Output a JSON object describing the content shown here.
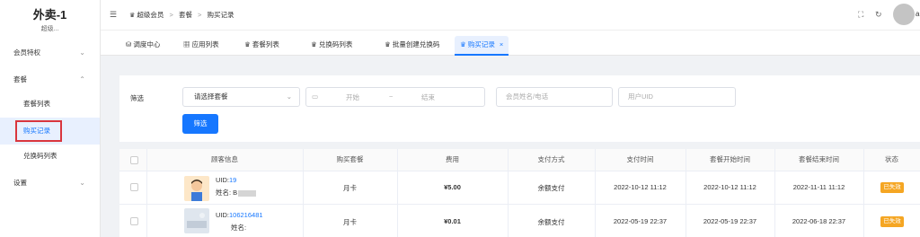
{
  "brand": {
    "title": "外卖-1",
    "subtitle": "超级..."
  },
  "sidebar": {
    "items": [
      {
        "label": "会员特权"
      },
      {
        "label": "套餐"
      },
      {
        "label": "套餐列表"
      },
      {
        "label": "购买记录"
      },
      {
        "label": "兑换码列表"
      },
      {
        "label": "设置"
      }
    ]
  },
  "header": {
    "breadcrumb": [
      "超级会员",
      "套餐",
      "购买记录"
    ],
    "user_initial": "a"
  },
  "tabs": [
    {
      "label": "调度中心"
    },
    {
      "label": "应用列表"
    },
    {
      "label": "套餐列表"
    },
    {
      "label": "兑换码列表"
    },
    {
      "label": "批量创建兑换码"
    },
    {
      "label": "购买记录"
    }
  ],
  "filter": {
    "label": "筛选",
    "package_select": "请选择套餐",
    "start_placeholder": "开始",
    "range_sep": "~",
    "end_placeholder": "结束",
    "member_placeholder": "会员姓名/电话",
    "uid_placeholder": "用户UID",
    "button": "筛选"
  },
  "table": {
    "headers": [
      "顾客信息",
      "购买套餐",
      "费用",
      "支付方式",
      "支付时间",
      "套餐开始时间",
      "套餐结束时间",
      "状态"
    ],
    "rows": [
      {
        "uid_label": "UID:",
        "uid": "19",
        "name_label": "姓名: B",
        "package": "月卡",
        "fee": "¥5.00",
        "payment": "余额支付",
        "pay_time": "2022-10-12 11:12",
        "start_time": "2022-10-12 11:12",
        "end_time": "2022-11-11 11:12",
        "status": "已失效"
      },
      {
        "uid_label": "UID:",
        "uid": "106216481",
        "name_label": "姓名:",
        "package": "月卡",
        "fee": "¥0.01",
        "payment": "余额支付",
        "pay_time": "2022-05-19 22:37",
        "start_time": "2022-05-19 22:37",
        "end_time": "2022-06-18 22:37",
        "status": "已失效"
      }
    ]
  },
  "colors": {
    "accent": "#1677ff",
    "status_badge": "#f5a623",
    "highlight_box": "#d9363e"
  }
}
